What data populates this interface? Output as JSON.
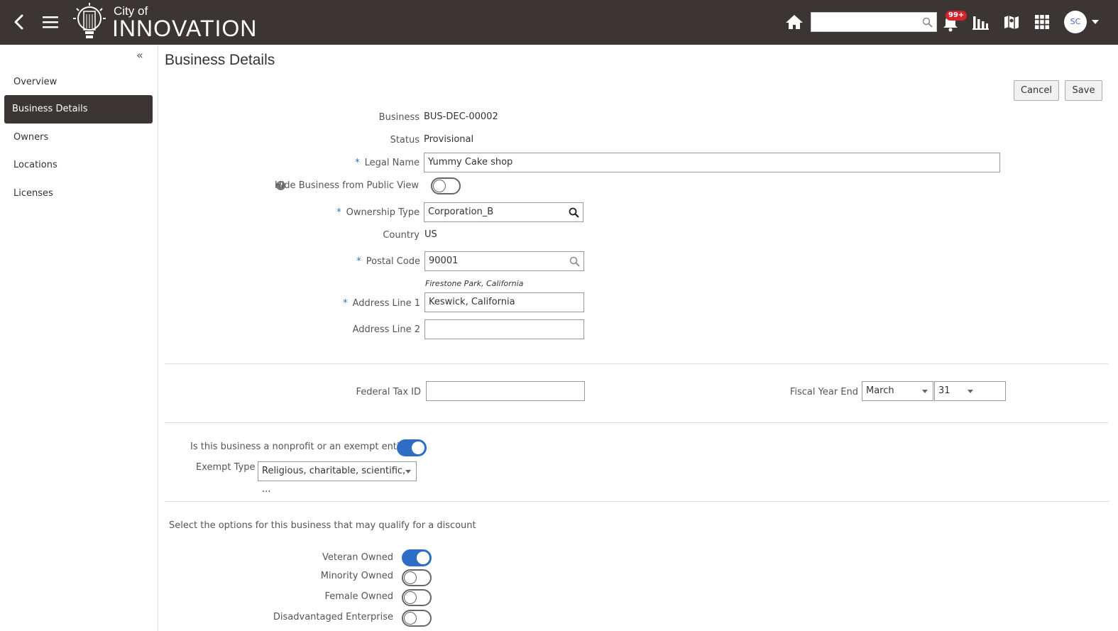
{
  "app": {
    "logo_small": "City of",
    "logo_big": "INNOVATION",
    "notifications_badge": "99+",
    "avatar_initials": "SC",
    "search_value": ""
  },
  "sidebar": {
    "items": [
      {
        "label": "Overview"
      },
      {
        "label": "Business Details",
        "active": true
      },
      {
        "label": "Owners"
      },
      {
        "label": "Locations"
      },
      {
        "label": "Licenses"
      }
    ]
  },
  "page": {
    "title": "Business Details",
    "cancel_label": "Cancel",
    "save_label": "Save"
  },
  "form": {
    "business_label": "Business",
    "business_value": "BUS-DEC-00002",
    "status_label": "Status",
    "status_value": "Provisional",
    "legal_name_label": "Legal Name",
    "legal_name_value": "Yummy Cake shop",
    "hide_label": "Hide Business from Public View",
    "hide_on": false,
    "ownership_type_label": "Ownership Type",
    "ownership_type_value": "Corporation_B",
    "country_label": "Country",
    "country_value": "US",
    "postal_code_label": "Postal Code",
    "postal_code_value": "90001",
    "postal_hint": "Firestone Park, California",
    "address1_label": "Address Line 1",
    "address1_value": "Keswick, California",
    "address2_label": "Address Line 2",
    "address2_value": "",
    "federal_tax_label": "Federal Tax ID",
    "federal_tax_value": "",
    "fiscal_year_label": "Fiscal Year End",
    "fiscal_month_value": "March",
    "fiscal_day_value": "31",
    "nonprofit_label": "Is this business a nonprofit or an exempt entity?",
    "nonprofit_on": true,
    "exempt_type_label": "Exempt Type",
    "exempt_type_value": "Religious, charitable, scientific, ...",
    "discount_intro": "Select the options for this business that may qualify for a discount",
    "discounts": [
      {
        "label": "Veteran Owned",
        "on": true
      },
      {
        "label": "Minority Owned",
        "on": false
      },
      {
        "label": "Female Owned",
        "on": false
      },
      {
        "label": "Disadvantaged Enterprise",
        "on": false
      }
    ]
  },
  "colors": {
    "header_bg": "#3b3633",
    "accent": "#2d6ec4",
    "badge": "#d7212b"
  }
}
